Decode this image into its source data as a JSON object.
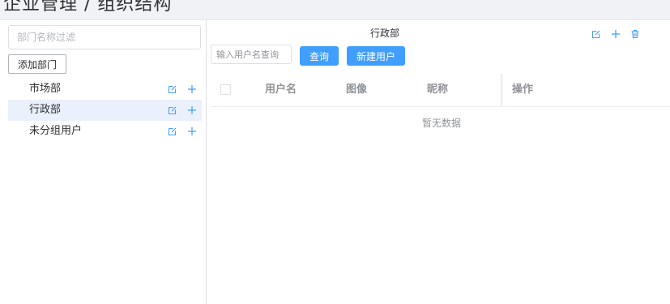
{
  "page": {
    "title": "企业管理 / 组织结构"
  },
  "left_panel": {
    "filter_placeholder": "部门名称过滤",
    "add_department_label": "添加部门",
    "departments": [
      {
        "label": "市场部",
        "active": false
      },
      {
        "label": "行政部",
        "active": true
      },
      {
        "label": "未分组用户",
        "active": false
      }
    ]
  },
  "right_panel": {
    "department_title": "行政部",
    "search_placeholder": "输入用户名查询",
    "query_label": "查询",
    "new_user_label": "新建用户",
    "table": {
      "columns": [
        "用户名",
        "图像",
        "昵称",
        "操作"
      ],
      "empty_text": "暂无数据"
    }
  },
  "colors": {
    "accent": "#409eff",
    "active_row": "#eaf1fc",
    "border": "#dcdfe6"
  },
  "icons": [
    "edit-icon",
    "plus-icon",
    "delete-icon"
  ]
}
